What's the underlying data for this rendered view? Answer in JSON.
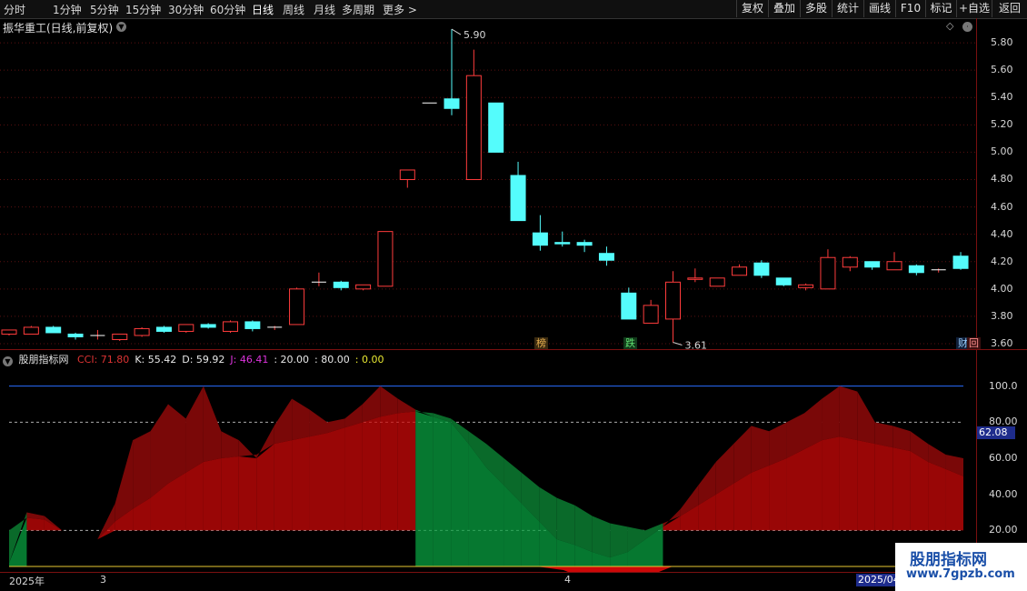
{
  "period_tabs": [
    {
      "label": "分时"
    },
    {
      "label": "1分钟"
    },
    {
      "label": "5分钟"
    },
    {
      "label": "15分钟"
    },
    {
      "label": "30分钟"
    },
    {
      "label": "60分钟"
    },
    {
      "label": "日线"
    },
    {
      "label": "周线"
    },
    {
      "label": "月线"
    },
    {
      "label": "多周期"
    },
    {
      "label": "更多 >"
    }
  ],
  "toolbar": [
    {
      "label": "复权"
    },
    {
      "label": "叠加"
    },
    {
      "label": "多股"
    },
    {
      "label": "统计"
    },
    {
      "label": "画线"
    },
    {
      "label": "F10"
    },
    {
      "label": "标记"
    },
    {
      "label": "+自选"
    },
    {
      "label": "返回"
    }
  ],
  "main_title": "振华重工(日线,前复权)",
  "chart_data": [
    {
      "type": "candlestick",
      "title": "振华重工(日线,前复权)",
      "ylim": [
        3.56,
        5.98
      ],
      "yticks": [
        "5.80",
        "5.60",
        "5.40",
        "5.20",
        "5.00",
        "4.80",
        "4.60",
        "4.40",
        "4.20",
        "4.00",
        "3.80",
        "3.60"
      ],
      "annotations": {
        "high": "5.90",
        "low": "3.61"
      },
      "markers": [
        "榜",
        "跌",
        "财",
        "回"
      ],
      "candles": [
        {
          "o": 3.67,
          "h": 3.7,
          "l": 3.66,
          "c": 3.7
        },
        {
          "o": 3.67,
          "h": 3.73,
          "l": 3.67,
          "c": 3.72
        },
        {
          "o": 3.72,
          "h": 3.73,
          "l": 3.68,
          "c": 3.68
        },
        {
          "o": 3.67,
          "h": 3.68,
          "l": 3.63,
          "c": 3.65
        },
        {
          "o": 3.66,
          "h": 3.7,
          "l": 3.63,
          "c": 3.66
        },
        {
          "o": 3.63,
          "h": 3.67,
          "l": 3.62,
          "c": 3.67
        },
        {
          "o": 3.66,
          "h": 3.72,
          "l": 3.65,
          "c": 3.71
        },
        {
          "o": 3.72,
          "h": 3.73,
          "l": 3.68,
          "c": 3.69
        },
        {
          "o": 3.69,
          "h": 3.74,
          "l": 3.68,
          "c": 3.74
        },
        {
          "o": 3.74,
          "h": 3.75,
          "l": 3.71,
          "c": 3.72
        },
        {
          "o": 3.69,
          "h": 3.77,
          "l": 3.68,
          "c": 3.76
        },
        {
          "o": 3.76,
          "h": 3.77,
          "l": 3.69,
          "c": 3.71
        },
        {
          "o": 3.72,
          "h": 3.73,
          "l": 3.7,
          "c": 3.72
        },
        {
          "o": 3.74,
          "h": 4.01,
          "l": 3.74,
          "c": 4.0
        },
        {
          "o": 4.05,
          "h": 4.12,
          "l": 4.02,
          "c": 4.05
        },
        {
          "o": 4.05,
          "h": 4.06,
          "l": 3.99,
          "c": 4.01
        },
        {
          "o": 4.0,
          "h": 4.03,
          "l": 3.99,
          "c": 4.03
        },
        {
          "o": 4.02,
          "h": 4.42,
          "l": 4.02,
          "c": 4.42
        },
        {
          "o": 4.8,
          "h": 4.87,
          "l": 4.74,
          "c": 4.87
        },
        {
          "o": 5.36,
          "h": 5.36,
          "l": 5.36,
          "c": 5.36
        },
        {
          "o": 5.39,
          "h": 5.9,
          "l": 5.27,
          "c": 5.32
        },
        {
          "o": 4.8,
          "h": 5.75,
          "l": 4.8,
          "c": 5.56
        },
        {
          "o": 5.36,
          "h": 5.36,
          "l": 5.0,
          "c": 5.0
        },
        {
          "o": 4.83,
          "h": 4.93,
          "l": 4.5,
          "c": 4.5
        },
        {
          "o": 4.41,
          "h": 4.54,
          "l": 4.28,
          "c": 4.32
        },
        {
          "o": 4.34,
          "h": 4.42,
          "l": 4.31,
          "c": 4.33
        },
        {
          "o": 4.34,
          "h": 4.36,
          "l": 4.27,
          "c": 4.32
        },
        {
          "o": 4.26,
          "h": 4.31,
          "l": 4.17,
          "c": 4.21
        },
        {
          "o": 3.97,
          "h": 4.01,
          "l": 3.78,
          "c": 3.78
        },
        {
          "o": 3.75,
          "h": 3.92,
          "l": 3.75,
          "c": 3.88
        },
        {
          "o": 3.78,
          "h": 4.13,
          "l": 3.61,
          "c": 4.05
        },
        {
          "o": 4.07,
          "h": 4.15,
          "l": 4.05,
          "c": 4.08
        },
        {
          "o": 4.02,
          "h": 4.08,
          "l": 4.02,
          "c": 4.08
        },
        {
          "o": 4.1,
          "h": 4.18,
          "l": 4.1,
          "c": 4.16
        },
        {
          "o": 4.19,
          "h": 4.21,
          "l": 4.08,
          "c": 4.1
        },
        {
          "o": 4.08,
          "h": 4.08,
          "l": 4.02,
          "c": 4.03
        },
        {
          "o": 4.01,
          "h": 4.04,
          "l": 3.99,
          "c": 4.03
        },
        {
          "o": 4.0,
          "h": 4.29,
          "l": 4.0,
          "c": 4.23
        },
        {
          "o": 4.16,
          "h": 4.24,
          "l": 4.13,
          "c": 4.23
        },
        {
          "o": 4.2,
          "h": 4.2,
          "l": 4.14,
          "c": 4.16
        },
        {
          "o": 4.14,
          "h": 4.27,
          "l": 4.14,
          "c": 4.2
        },
        {
          "o": 4.17,
          "h": 4.18,
          "l": 4.1,
          "c": 4.12
        },
        {
          "o": 4.14,
          "h": 4.15,
          "l": 4.12,
          "c": 4.14
        },
        {
          "o": 4.24,
          "h": 4.27,
          "l": 4.14,
          "c": 4.15
        }
      ]
    },
    {
      "type": "area",
      "title": "股朋指标网",
      "ylim": [
        -3,
        120
      ],
      "yticks": [
        "100.0",
        "80.00",
        "60.00",
        "40.00",
        "20.00",
        "0.00"
      ],
      "legend": [
        {
          "label": "CCI: 71.80",
          "color": "#dd3333"
        },
        {
          "label": "K: 55.42",
          "color": "#e8e8e8"
        },
        {
          "label": "D: 59.92",
          "color": "#e8e8e8"
        },
        {
          "label": "J: 46.41",
          "color": "#dd33dd"
        },
        {
          "label": ": 20.00",
          "color": "#e8e8e8"
        },
        {
          "label": ": 80.00",
          "color": "#e8e8e8"
        },
        {
          "label": ": 0.00",
          "color": "#e8e832"
        }
      ],
      "current_value": "62.08",
      "x_labels": [
        "2025年",
        "3",
        "4"
      ],
      "date_tag": "2025/04",
      "upper_line": [
        2,
        30,
        28,
        20,
        17,
        15,
        35,
        70,
        75,
        90,
        82,
        100,
        75,
        70,
        60,
        78,
        93,
        87,
        80,
        82,
        90,
        100,
        93,
        87,
        83,
        80,
        68,
        55,
        45,
        35,
        25,
        15,
        12,
        8,
        5,
        8,
        15,
        22,
        32,
        45,
        58,
        68,
        78,
        75,
        80,
        85,
        93,
        100,
        97,
        80,
        78,
        75,
        68,
        62,
        60
      ],
      "lower_line": [
        20,
        27,
        26,
        20,
        17,
        15,
        25,
        32,
        38,
        46,
        52,
        58,
        60,
        61,
        62,
        68,
        70,
        72,
        74,
        77,
        80,
        83,
        85,
        86,
        85,
        82,
        75,
        68,
        60,
        52,
        44,
        38,
        34,
        28,
        24,
        22,
        20,
        24,
        28,
        34,
        40,
        46,
        52,
        56,
        60,
        65,
        70,
        72,
        70,
        68,
        66,
        64,
        58,
        54,
        50
      ]
    }
  ],
  "watermark": {
    "line1": "股朋指标网",
    "line2": "www.7gpzb.com"
  }
}
